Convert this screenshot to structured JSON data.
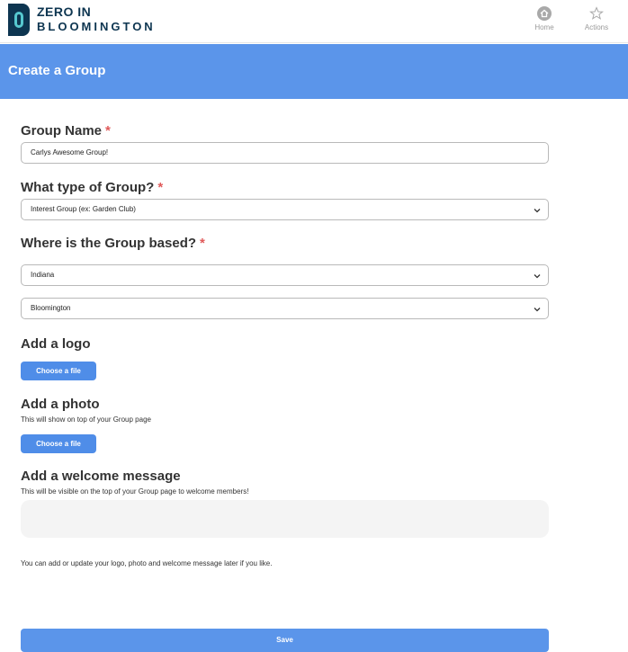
{
  "header": {
    "logo_line1": "ZERO IN",
    "logo_line2": "BLOOMINGTON",
    "nav": [
      {
        "label": "Home",
        "icon": "home-icon"
      },
      {
        "label": "Actions",
        "icon": "star-icon"
      }
    ]
  },
  "banner": {
    "title": "Create a Group"
  },
  "form": {
    "group_name": {
      "label": "Group Name",
      "required": "*",
      "value": "Carlys Awesome Group!"
    },
    "group_type": {
      "label": "What type of Group?",
      "required": "*",
      "selected": "Interest Group (ex: Garden Club)"
    },
    "location": {
      "label": "Where is the Group based?",
      "required": "*",
      "state_selected": "Indiana",
      "city_selected": "Bloomington"
    },
    "logo": {
      "label": "Add a logo",
      "button": "Choose a file"
    },
    "photo": {
      "label": "Add a photo",
      "hint": "This will show on top of your Group page",
      "button": "Choose a file"
    },
    "welcome": {
      "label": "Add a welcome message",
      "hint": "This will be visible on the top of your Group page to welcome members!",
      "value": ""
    },
    "note": "You can add or update your logo, photo and welcome message later if you like.",
    "save_label": "Save"
  },
  "colors": {
    "accent": "#5b95ea",
    "button": "#4f8de8",
    "required": "#e05a5a",
    "brand_dark": "#0d3550",
    "brand_teal": "#56c8cf"
  }
}
